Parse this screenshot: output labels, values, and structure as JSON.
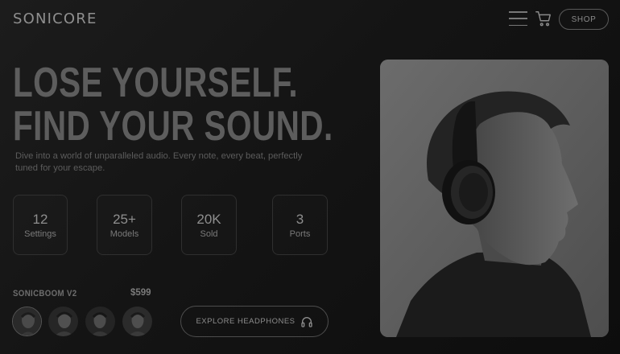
{
  "header": {
    "brand": "SONICORE",
    "shop_label": "SHOP",
    "icons": [
      "menu-icon",
      "cart-icon"
    ]
  },
  "hero": {
    "headline_line1": "LOSE YOURSELF.",
    "headline_line2": "FIND YOUR SOUND.",
    "subtitle": "Dive into a world of unparalleled audio. Every note, every beat, perfectly tuned for your escape."
  },
  "stats": [
    {
      "value": "12",
      "label": "Settings"
    },
    {
      "value": "25+",
      "label": "Models"
    },
    {
      "value": "20K",
      "label": "Sold"
    },
    {
      "value": "3",
      "label": "Ports"
    }
  ],
  "product": {
    "name": "SONICBOOM V2",
    "price": "$599",
    "thumbnails_count": 4
  },
  "cta": {
    "label": "EXPLORE HEADPHONES",
    "icon": "headphones-icon"
  },
  "colors": {
    "background": "#141414",
    "text_primary": "#8e8e8e",
    "headline": "#5d5d5d",
    "border": "#2f2f2f"
  }
}
